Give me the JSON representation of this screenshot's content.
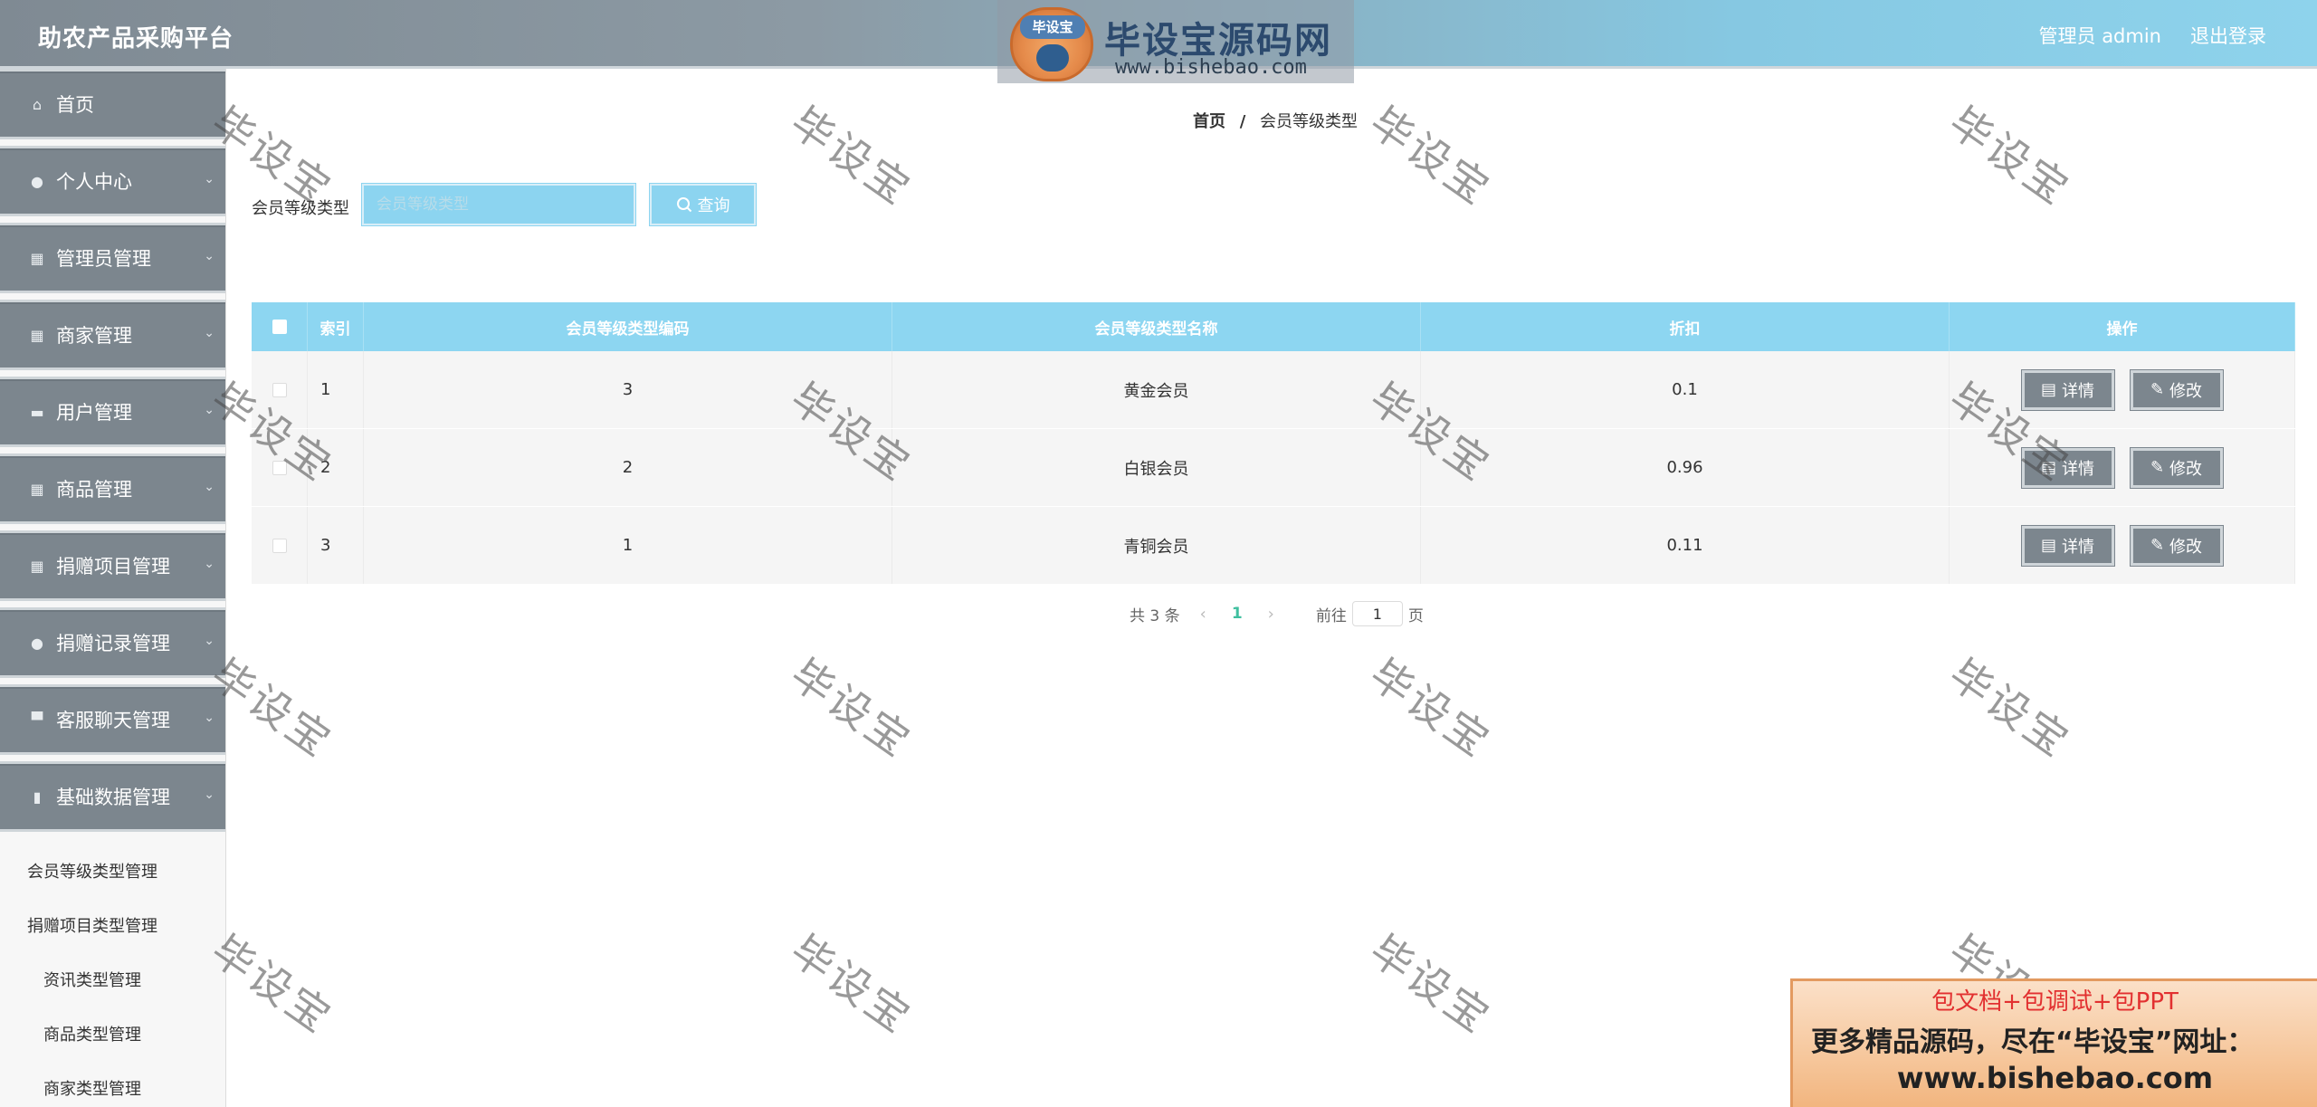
{
  "header": {
    "app_title": "助农产品采购平台",
    "admin_label": "管理员 admin",
    "logout_label": "退出登录",
    "logo_badge": "毕设宝",
    "logo_text": "毕设宝源码网",
    "logo_url": "www.bishebao.com"
  },
  "sidebar": {
    "items": [
      {
        "label": "首页",
        "icon": "home-icon"
      },
      {
        "label": "个人中心",
        "icon": "user-icon"
      },
      {
        "label": "管理员管理",
        "icon": "grid-icon"
      },
      {
        "label": "商家管理",
        "icon": "grid-icon"
      },
      {
        "label": "用户管理",
        "icon": "ticket-icon"
      },
      {
        "label": "商品管理",
        "icon": "grid-icon"
      },
      {
        "label": "捐赠项目管理",
        "icon": "grid-icon"
      },
      {
        "label": "捐赠记录管理",
        "icon": "user-icon"
      },
      {
        "label": "客服聊天管理",
        "icon": "chat-icon"
      },
      {
        "label": "基础数据管理",
        "icon": "chart-icon"
      }
    ],
    "sub_items": [
      "会员等级类型管理",
      "捐赠项目类型管理",
      "资讯类型管理",
      "商品类型管理",
      "商家类型管理"
    ]
  },
  "breadcrumb": {
    "home": "首页",
    "separator": "/",
    "current": "会员等级类型"
  },
  "search": {
    "label": "会员等级类型",
    "placeholder": "会员等级类型",
    "button_label": "查询"
  },
  "table": {
    "headers": [
      "索引",
      "会员等级类型编码",
      "会员等级类型名称",
      "折扣",
      "操作"
    ],
    "rows": [
      {
        "index": "1",
        "code": "3",
        "name": "黄金会员",
        "discount": "0.1"
      },
      {
        "index": "2",
        "code": "2",
        "name": "白银会员",
        "discount": "0.96"
      },
      {
        "index": "3",
        "code": "1",
        "name": "青铜会员",
        "discount": "0.11"
      }
    ],
    "detail_label": "详情",
    "edit_label": "修改"
  },
  "pagination": {
    "total": "共 3 条",
    "current_page": "1",
    "goto_label": "前往",
    "goto_value": "1",
    "unit": "页"
  },
  "watermark": "毕设宝",
  "promo": {
    "line1": "包文档+包调试+包PPT",
    "line2": "更多精品源码，尽在“毕设宝”网址：",
    "line3": "www.bishebao.com"
  }
}
